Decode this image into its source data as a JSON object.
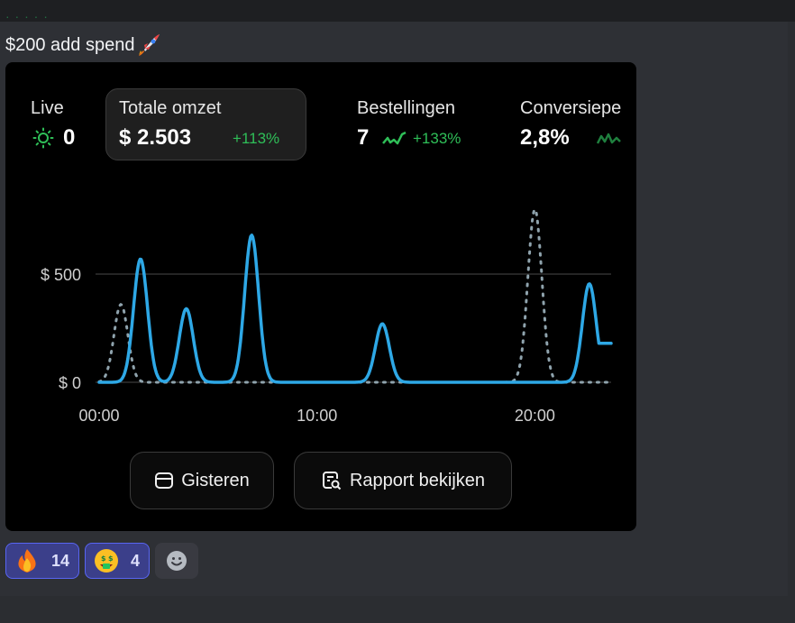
{
  "message": {
    "text": "$200 add spend"
  },
  "dashboard": {
    "live": {
      "label": "Live",
      "value": "0"
    },
    "total_revenue": {
      "label": "Totale omzet",
      "value": "$ 2.503",
      "delta": "+113%"
    },
    "orders": {
      "label": "Bestellingen",
      "value": "7",
      "delta": "+133%"
    },
    "conversion": {
      "label": "Conversiepe",
      "value": "2,8%"
    },
    "buttons": {
      "yesterday": "Gisteren",
      "view_report": "Rapport bekijken"
    }
  },
  "chart_data": {
    "type": "line",
    "x_tick_labels": [
      "00:00",
      "10:00",
      "20:00"
    ],
    "y_tick_labels": [
      "$ 500",
      "$ 0"
    ],
    "xlim": [
      0,
      23.5
    ],
    "ylim": [
      0,
      700
    ],
    "grid": true,
    "series": [
      {
        "style": "solid",
        "color": "#2ea8e6",
        "peaks": [
          [
            1.9,
            570
          ],
          [
            4.0,
            340
          ],
          [
            7.0,
            680
          ],
          [
            13.0,
            270
          ],
          [
            22.5,
            455
          ]
        ],
        "end_value": 180
      },
      {
        "style": "dotted",
        "color": "#8fa3ad",
        "peaks": [
          [
            1.0,
            360
          ],
          [
            20.0,
            800
          ]
        ],
        "end_value": 0
      }
    ]
  },
  "reactions": [
    {
      "emoji": "fire",
      "count": "14"
    },
    {
      "emoji": "money-mouth-face",
      "count": "4"
    }
  ],
  "colors": {
    "accent_blue": "#2ea8e6",
    "positive_green": "#2fbf58",
    "reaction_bg": "#3b3f8a",
    "reaction_border": "#5865f2"
  }
}
